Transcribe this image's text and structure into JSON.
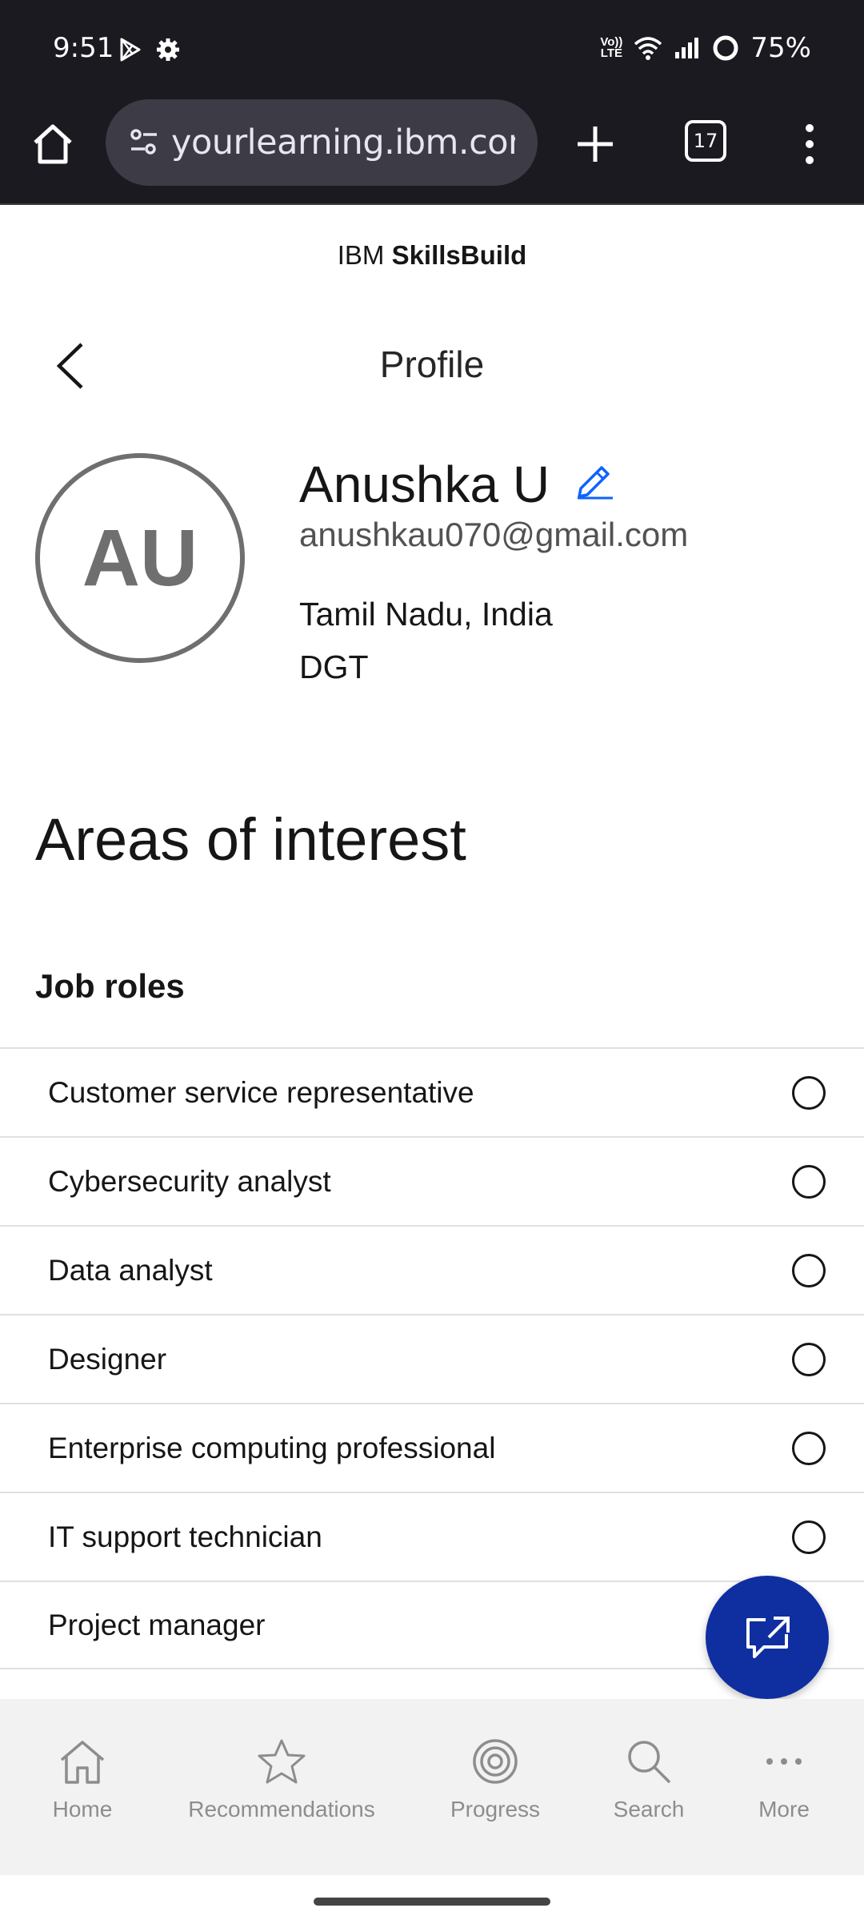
{
  "status_bar": {
    "time": "9:51",
    "battery": "75%",
    "volte_top": "Vo))",
    "volte_bottom": "LTE"
  },
  "browser": {
    "url": "yourlearning.ibm.com",
    "tab_count": "17"
  },
  "header": {
    "brand_prefix": "IBM",
    "brand_name": "SkillsBuild",
    "title": "Profile"
  },
  "profile": {
    "initials": "AU",
    "name": "Anushka U",
    "email": "anushkau070@gmail.com",
    "location": "Tamil Nadu, India",
    "organization": "DGT"
  },
  "interests": {
    "title": "Areas of interest",
    "job_roles_title": "Job roles",
    "roles": [
      "Customer service representative",
      "Cybersecurity analyst",
      "Data analyst",
      "Designer",
      "Enterprise computing professional",
      "IT support technician",
      "Project manager"
    ]
  },
  "bottom_nav": {
    "home": "Home",
    "recommendations": "Recommendations",
    "progress": "Progress",
    "search": "Search",
    "more": "More"
  },
  "colors": {
    "browser_bg": "#1b1a21",
    "accent_blue": "#0f2ea0",
    "link_blue": "#0f62fe"
  }
}
